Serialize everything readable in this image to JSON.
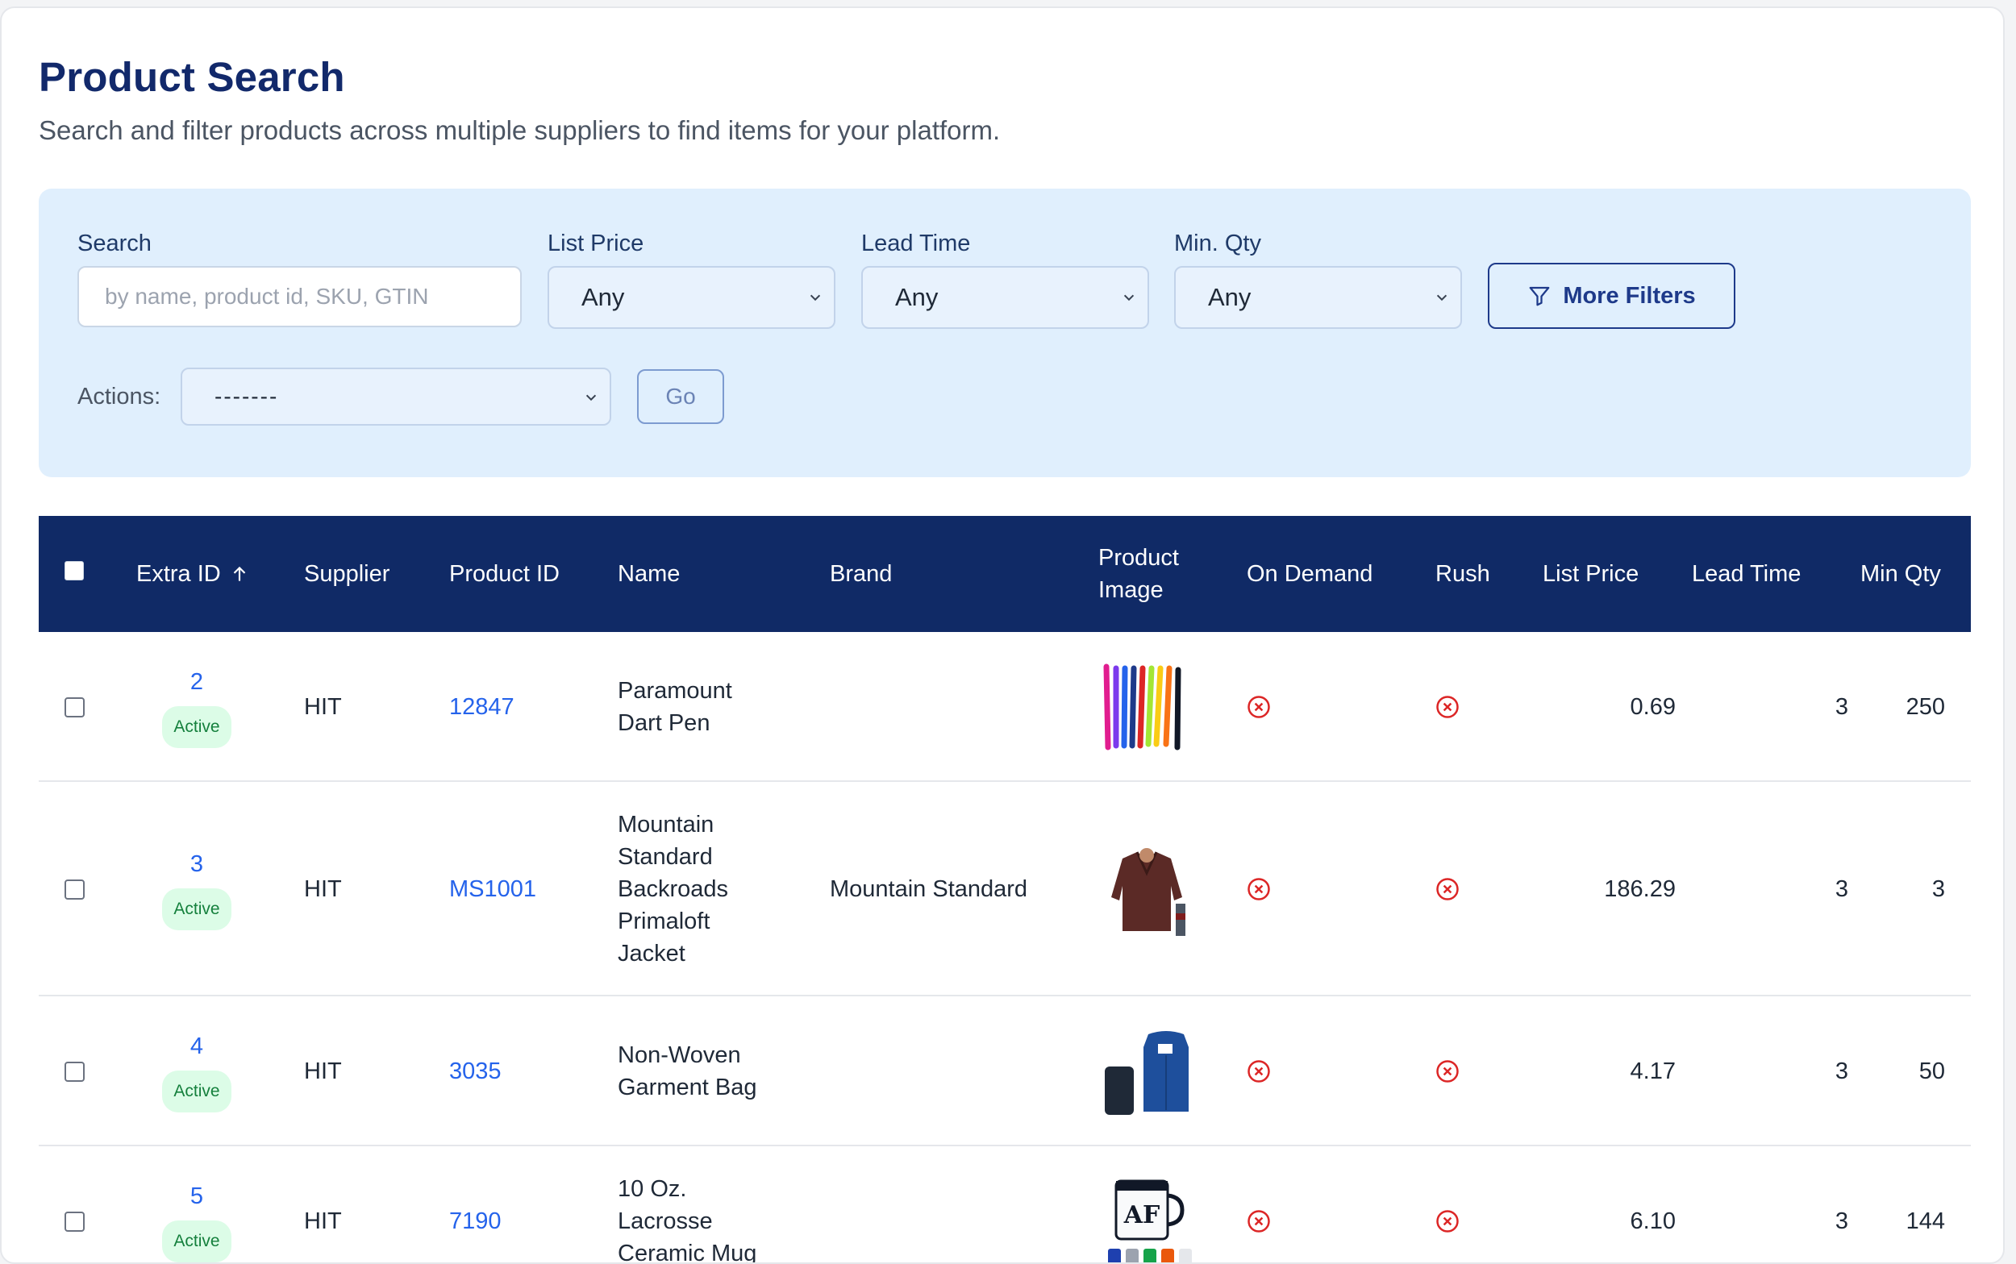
{
  "page": {
    "title": "Product Search",
    "subtitle": "Search and filter products across multiple suppliers to find items for your platform."
  },
  "filters": {
    "search_label": "Search",
    "search_placeholder": "by name, product id, SKU, GTIN",
    "list_price_label": "List Price",
    "list_price_value": "Any",
    "lead_time_label": "Lead Time",
    "lead_time_value": "Any",
    "min_qty_label": "Min. Qty",
    "min_qty_value": "Any",
    "more_filters_label": "More Filters",
    "actions_label": "Actions:",
    "actions_value": "-------",
    "go_label": "Go"
  },
  "table": {
    "headers": {
      "extra_id": "Extra ID",
      "supplier": "Supplier",
      "product_id": "Product ID",
      "name": "Name",
      "brand": "Brand",
      "product_image": "Product Image",
      "on_demand": "On Demand",
      "rush": "Rush",
      "list_price": "List Price",
      "lead_time": "Lead Time",
      "min_qty": "Min Qty"
    },
    "rows": [
      {
        "extra_id": "2",
        "status": "Active",
        "supplier": "HIT",
        "product_id": "12847",
        "name": "Paramount Dart Pen",
        "brand": "",
        "list_price": "0.69",
        "lead_time": "3",
        "min_qty": "250"
      },
      {
        "extra_id": "3",
        "status": "Active",
        "supplier": "HIT",
        "product_id": "MS1001",
        "name": "Mountain Standard Backroads Primaloft Jacket",
        "brand": "Mountain Standard",
        "list_price": "186.29",
        "lead_time": "3",
        "min_qty": "3"
      },
      {
        "extra_id": "4",
        "status": "Active",
        "supplier": "HIT",
        "product_id": "3035",
        "name": "Non-Woven Garment Bag",
        "brand": "",
        "list_price": "4.17",
        "lead_time": "3",
        "min_qty": "50"
      },
      {
        "extra_id": "5",
        "status": "Active",
        "supplier": "HIT",
        "product_id": "7190",
        "name": "10 Oz. Lacrosse Ceramic Mug",
        "brand": "",
        "list_price": "6.10",
        "lead_time": "3",
        "min_qty": "144"
      }
    ]
  },
  "colors": {
    "primary": "#102a66",
    "link": "#2563eb",
    "filter_bg": "#e0effd",
    "badge_bg": "#dcfce7",
    "badge_text": "#15803d",
    "x_icon": "#dc2626"
  },
  "icons": [
    "filter-icon",
    "chevron-down-icon",
    "sort-arrow-up-icon",
    "x-circle-icon"
  ]
}
